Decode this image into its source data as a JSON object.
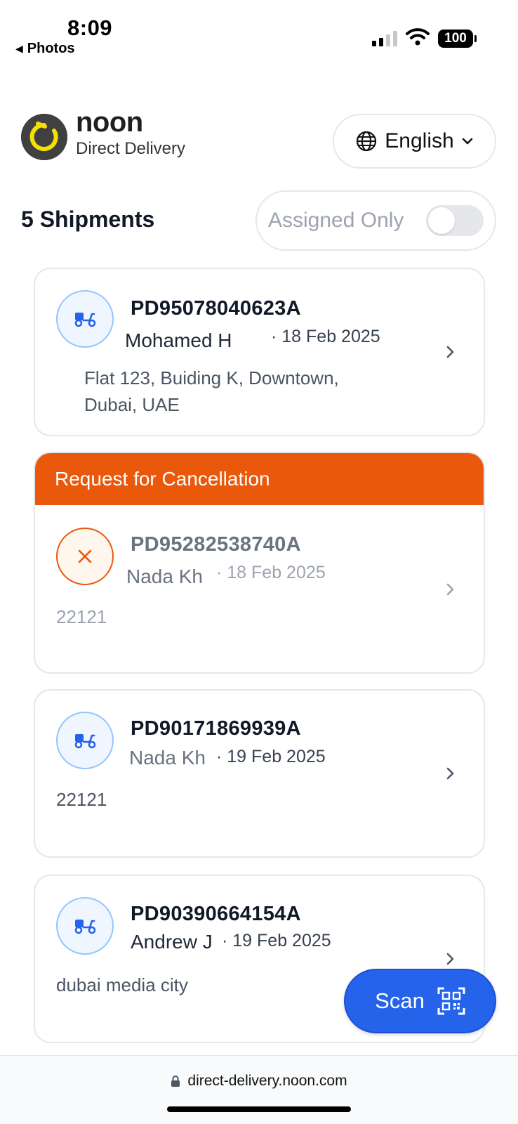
{
  "status_bar": {
    "time": "8:09",
    "back_app": "Photos",
    "battery": "100"
  },
  "header": {
    "brand_name": "noon",
    "brand_sub": "Direct Delivery",
    "language": "English",
    "icons": {
      "language": "globe-icon",
      "dropdown": "chevron-down-icon"
    }
  },
  "list": {
    "title": "5 Shipments",
    "filter_label": "Assigned Only",
    "filter_enabled": false
  },
  "shipments": [
    {
      "awb": "PD95078040623A",
      "customer": "Mohamed H",
      "date": "· 18 Feb 2025",
      "address_line1": "Flat 123, Buiding K, Downtown,",
      "address_line2": "Dubai, UAE",
      "icon": "scooter-icon"
    },
    {
      "banner": "Request for Cancellation",
      "awb": "PD95282538740A",
      "customer": "Nada Kh",
      "date": "· 18 Feb 2025",
      "address_line1": "22121",
      "icon": "close-icon"
    },
    {
      "awb": "PD90171869939A",
      "customer": "Nada Kh",
      "date": "· 19 Feb 2025",
      "address_line1": "22121",
      "icon": "scooter-icon"
    },
    {
      "awb": "PD90390664154A",
      "customer": "Andrew J",
      "date": "· 19 Feb 2025",
      "address_line1": "dubai media city",
      "icon": "scooter-icon"
    }
  ],
  "scan": {
    "label": "Scan",
    "icon": "qr-code-icon"
  },
  "browser": {
    "url": "direct-delivery.noon.com"
  },
  "colors": {
    "accent_blue": "#2563eb",
    "cancel_orange": "#ea580c",
    "brand_yellow": "#f5e000"
  }
}
